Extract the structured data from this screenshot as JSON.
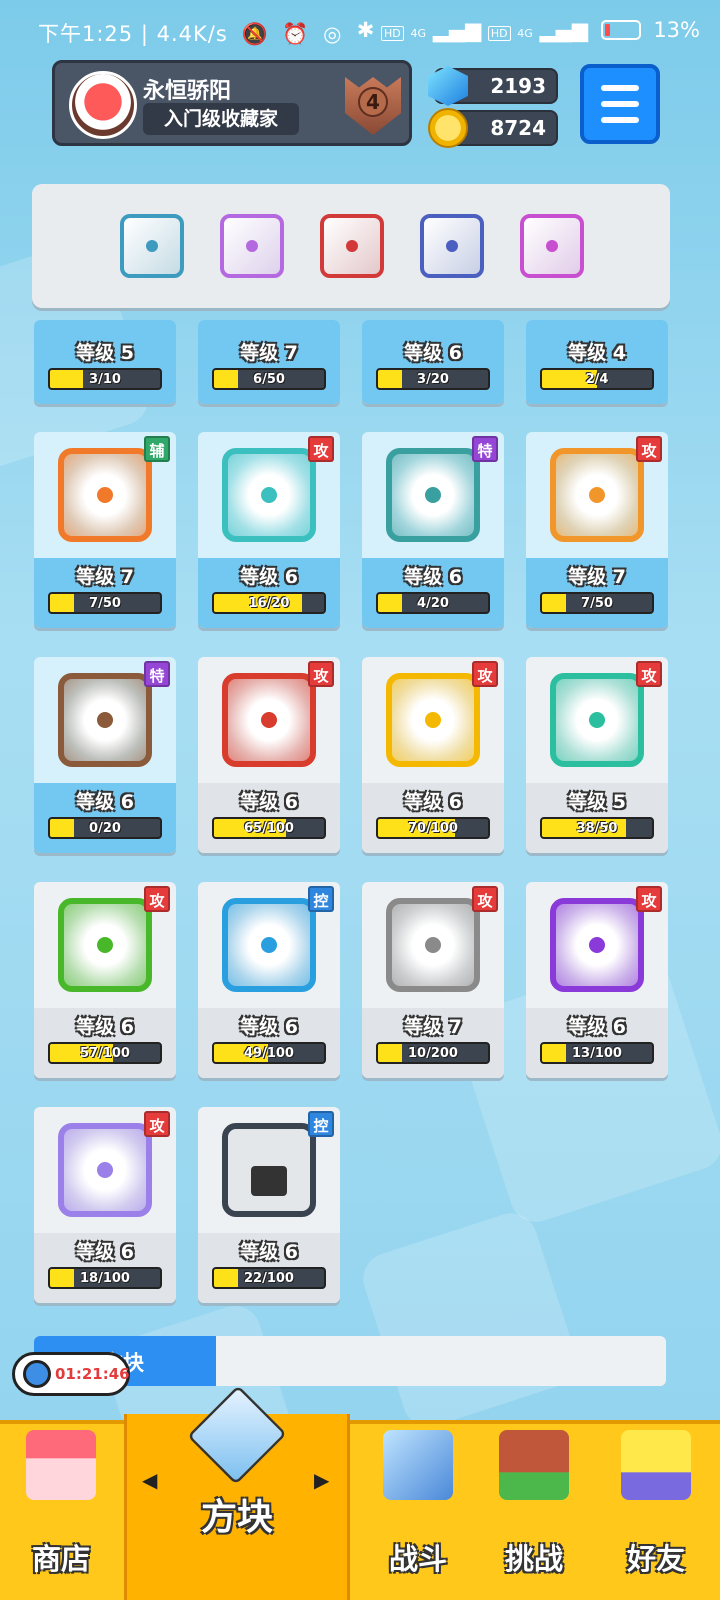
{
  "status_bar": {
    "time": "下午1:25",
    "speed": "4.4K/s",
    "net1": "HD",
    "net2": "4G",
    "net3": "HD",
    "net4": "4G",
    "battery": "13%"
  },
  "profile": {
    "name": "永恒骄阳",
    "rank_title": "入门级收藏家",
    "trophy_level": "4"
  },
  "currency": {
    "gems": "2193",
    "coins": "8724"
  },
  "equipped_dice": [
    {
      "name": "storm-dice",
      "color": "#3c9bbf"
    },
    {
      "name": "rainbow-dice",
      "color": "#b469e0"
    },
    {
      "name": "crack-dice",
      "color": "#d23a3a"
    },
    {
      "name": "gear-dice",
      "color": "#4a5fc0"
    },
    {
      "name": "teleport-dice",
      "color": "#c84fd0"
    }
  ],
  "level_label": "等级",
  "tags": {
    "attack": "攻",
    "support": "辅",
    "special": "特",
    "control": "控"
  },
  "dice_cards": [
    {
      "level": "5",
      "progress": "3/10",
      "fill": 0.3,
      "tag": "",
      "color": "#8ab",
      "blue": true,
      "partial": true
    },
    {
      "level": "7",
      "progress": "6/50",
      "fill": 0.12,
      "tag": "",
      "color": "#8ab",
      "blue": true,
      "partial": true
    },
    {
      "level": "6",
      "progress": "3/20",
      "fill": 0.15,
      "tag": "",
      "color": "#8ab",
      "blue": true,
      "partial": true
    },
    {
      "level": "4",
      "progress": "2/4",
      "fill": 0.5,
      "tag": "",
      "color": "#8ab",
      "blue": true,
      "partial": true
    },
    {
      "level": "7",
      "progress": "7/50",
      "fill": 0.14,
      "tag": "support",
      "color": "#f07a2a",
      "blue": true
    },
    {
      "level": "6",
      "progress": "16/20",
      "fill": 0.8,
      "tag": "attack",
      "color": "#3bbfbf",
      "blue": true
    },
    {
      "level": "6",
      "progress": "4/20",
      "fill": 0.2,
      "tag": "special",
      "color": "#3a9f9f",
      "blue": true
    },
    {
      "level": "7",
      "progress": "7/50",
      "fill": 0.14,
      "tag": "attack",
      "color": "#f0962a",
      "blue": true
    },
    {
      "level": "6",
      "progress": "0/20",
      "fill": 0.0,
      "tag": "special",
      "color": "#8a5a3a",
      "blue": true
    },
    {
      "level": "6",
      "progress": "65/100",
      "fill": 0.65,
      "tag": "attack",
      "color": "#d83c2c",
      "blue": false
    },
    {
      "level": "6",
      "progress": "70/100",
      "fill": 0.7,
      "tag": "attack",
      "color": "#f5b800",
      "blue": false
    },
    {
      "level": "5",
      "progress": "38/50",
      "fill": 0.76,
      "tag": "attack",
      "color": "#2bbf9f",
      "blue": false
    },
    {
      "level": "6",
      "progress": "57/100",
      "fill": 0.57,
      "tag": "attack",
      "color": "#48b82a",
      "blue": false
    },
    {
      "level": "6",
      "progress": "49/100",
      "fill": 0.49,
      "tag": "control",
      "color": "#2a9fdf",
      "blue": false
    },
    {
      "level": "7",
      "progress": "10/200",
      "fill": 0.05,
      "tag": "attack",
      "color": "#8a8a8a",
      "blue": false
    },
    {
      "level": "6",
      "progress": "13/100",
      "fill": 0.13,
      "tag": "attack",
      "color": "#8a3ad8",
      "blue": false
    },
    {
      "level": "6",
      "progress": "18/100",
      "fill": 0.18,
      "tag": "attack",
      "color": "#9a80e8",
      "blue": false
    },
    {
      "level": "6",
      "progress": "22/100",
      "fill": 0.22,
      "tag": "control",
      "color": "#3a4450",
      "blue": false,
      "lock": true
    }
  ],
  "section": {
    "title": "方块"
  },
  "timer": "01:21:46",
  "nav": {
    "shop": "商店",
    "dice": "方块",
    "battle": "战斗",
    "challenge": "挑战",
    "friends": "好友"
  }
}
